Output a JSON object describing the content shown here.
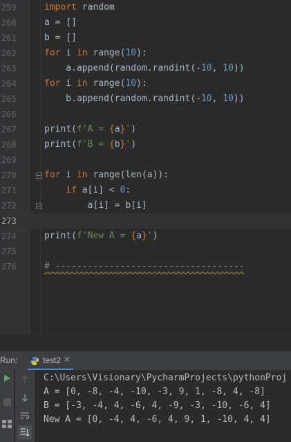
{
  "editor": {
    "lines": [
      {
        "num": "259",
        "tokens": [
          [
            "kw",
            "import"
          ],
          [
            "plain",
            " random"
          ]
        ]
      },
      {
        "num": "260",
        "tokens": [
          [
            "plain",
            "a = []"
          ]
        ]
      },
      {
        "num": "261",
        "tokens": [
          [
            "plain",
            "b = []"
          ]
        ]
      },
      {
        "num": "262",
        "tokens": [
          [
            "kw",
            "for"
          ],
          [
            "plain",
            " i "
          ],
          [
            "kw",
            "in"
          ],
          [
            "plain",
            " range("
          ],
          [
            "num",
            "10"
          ],
          [
            "plain",
            "):"
          ]
        ]
      },
      {
        "num": "263",
        "tokens": [
          [
            "plain",
            "    a.append(random.randint(-"
          ],
          [
            "num",
            "10"
          ],
          [
            "plain",
            ", "
          ],
          [
            "num",
            "10"
          ],
          [
            "plain",
            "))"
          ]
        ]
      },
      {
        "num": "264",
        "tokens": [
          [
            "kw",
            "for"
          ],
          [
            "plain",
            " i "
          ],
          [
            "kw",
            "in"
          ],
          [
            "plain",
            " range("
          ],
          [
            "num",
            "10"
          ],
          [
            "plain",
            "):"
          ]
        ]
      },
      {
        "num": "265",
        "tokens": [
          [
            "plain",
            "    b.append(random.randint(-"
          ],
          [
            "num",
            "10"
          ],
          [
            "plain",
            ", "
          ],
          [
            "num",
            "10"
          ],
          [
            "plain",
            "))"
          ]
        ]
      },
      {
        "num": "266",
        "tokens": []
      },
      {
        "num": "267",
        "tokens": [
          [
            "plain",
            "print("
          ],
          [
            "str",
            "f'A = "
          ],
          [
            "fb",
            "{"
          ],
          [
            "plain",
            "a"
          ],
          [
            "fb",
            "}"
          ],
          [
            "str",
            "'"
          ],
          [
            "plain",
            ")"
          ]
        ]
      },
      {
        "num": "268",
        "tokens": [
          [
            "plain",
            "print("
          ],
          [
            "str",
            "f'B = "
          ],
          [
            "fb",
            "{"
          ],
          [
            "plain",
            "b"
          ],
          [
            "fb",
            "}"
          ],
          [
            "str",
            "'"
          ],
          [
            "plain",
            ")"
          ]
        ]
      },
      {
        "num": "269",
        "tokens": []
      },
      {
        "num": "270",
        "tokens": [
          [
            "kw",
            "for"
          ],
          [
            "plain",
            " i "
          ],
          [
            "kw",
            "in"
          ],
          [
            "plain",
            " range(len(a)):"
          ]
        ]
      },
      {
        "num": "271",
        "tokens": [
          [
            "plain",
            "    "
          ],
          [
            "kw",
            "if"
          ],
          [
            "plain",
            " a[i] < "
          ],
          [
            "num",
            "0"
          ],
          [
            "plain",
            ":"
          ]
        ]
      },
      {
        "num": "272",
        "tokens": [
          [
            "plain",
            "        a[i] = b[i]"
          ]
        ]
      },
      {
        "num": "273",
        "tokens": []
      },
      {
        "num": "274",
        "tokens": [
          [
            "plain",
            "print("
          ],
          [
            "str",
            "f'New A = "
          ],
          [
            "fb",
            "{"
          ],
          [
            "plain",
            "a"
          ],
          [
            "fb",
            "}"
          ],
          [
            "str",
            "'"
          ],
          [
            "plain",
            ")"
          ]
        ]
      },
      {
        "num": "275",
        "tokens": []
      },
      {
        "num": "276",
        "tokens": [
          [
            "comment",
            "# -----------------------------------"
          ]
        ]
      }
    ]
  },
  "run": {
    "label": "Run:",
    "tab_label": "test2",
    "tab_close": "✕",
    "output": [
      "C:\\Users\\Visionary\\PycharmProjects\\pythonProj",
      "A = [0, -8, -4, -10, -3, 9, 1, -8, 4, -8]",
      "B = [-3, -4, 4, -6, 4, -9, -3, -10, -6, 4]",
      "New A = [0, -4, 4, -6, 4, 9, 1, -10, 4, 4]"
    ]
  },
  "colors": {
    "keyword": "#cc7832",
    "number": "#6897bb",
    "string": "#6a8759",
    "run_green": "#59a869",
    "tab_underline": "#4a88c7"
  }
}
